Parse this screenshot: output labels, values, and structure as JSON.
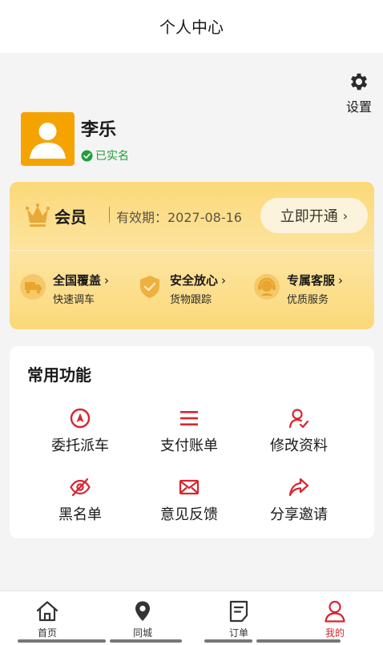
{
  "header": {
    "title": "个人中心"
  },
  "settings": {
    "label": "设置",
    "icon": "gear-icon"
  },
  "profile": {
    "name": "李乐",
    "verified_label": "已实名",
    "avatar_color": "#f5a300"
  },
  "vip": {
    "title": "会员",
    "expiry": "有效期：2027-08-16",
    "open_button": "立即开通",
    "chevron": "›",
    "perks": [
      {
        "title": "全国覆盖",
        "sub": "快速调车",
        "icon": "truck-icon"
      },
      {
        "title": "安全放心",
        "sub": "货物跟踪",
        "icon": "shield-check-icon"
      },
      {
        "title": "专属客服",
        "sub": "优质服务",
        "icon": "customer-service-icon"
      }
    ]
  },
  "functions": {
    "title": "常用功能",
    "accent": "#d8252f",
    "items": [
      {
        "label": "委托派车",
        "icon": "navigation-icon"
      },
      {
        "label": "支付账单",
        "icon": "menu-lines-icon"
      },
      {
        "label": "修改资料",
        "icon": "user-edit-icon"
      },
      {
        "label": "黑名单",
        "icon": "eye-off-icon"
      },
      {
        "label": "意见反馈",
        "icon": "mail-icon"
      },
      {
        "label": "分享邀请",
        "icon": "share-arrow-icon"
      }
    ]
  },
  "tabbar": {
    "items": [
      {
        "label": "首页",
        "icon": "home-icon",
        "active": false
      },
      {
        "label": "同城",
        "icon": "location-pin-icon",
        "active": false
      },
      {
        "label": "订单",
        "icon": "order-document-icon",
        "active": false
      },
      {
        "label": "我的",
        "icon": "user-icon",
        "active": true
      }
    ],
    "active_color": "#d8252f"
  }
}
